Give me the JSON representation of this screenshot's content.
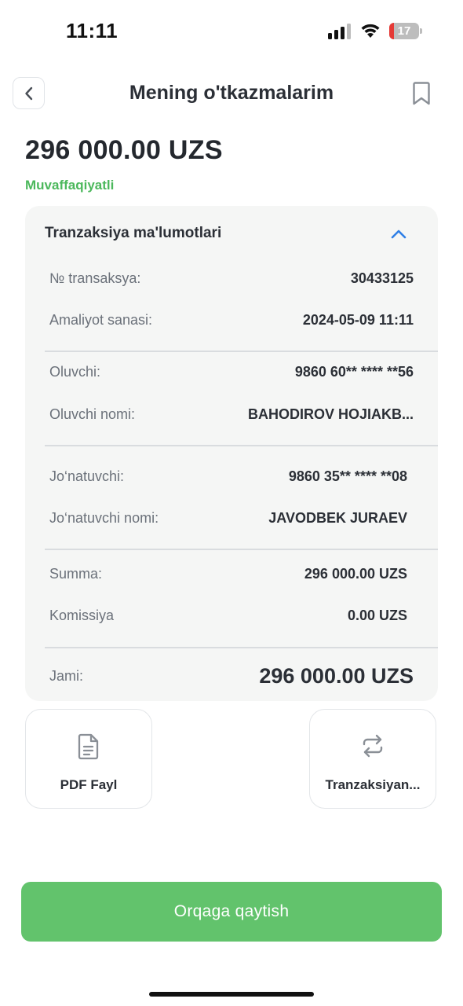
{
  "status_bar": {
    "time": "11:11",
    "battery_level": "17",
    "battery_fraction": 0.17,
    "battery_color": "#e53935",
    "icons": [
      "signal-icon",
      "wifi-icon",
      "battery-icon"
    ]
  },
  "header": {
    "title": "Mening o'tkazmalarim",
    "back_icon": "chevron-left-icon",
    "bookmark_icon": "bookmark-icon"
  },
  "amount": {
    "value": "296 000.00 UZS",
    "status": "Muvaffaqiyatli",
    "status_color": "#4cb85c"
  },
  "details": {
    "title": "Tranzaksiya ma'lumotlari",
    "collapse_icon": "chevron-up-icon",
    "rows": [
      {
        "label": "№ transaksya:",
        "value": "30433125"
      },
      {
        "label": "Amaliyot sanasi:",
        "value": "2024-05-09 11:11"
      },
      {
        "label": "Oluvchi:",
        "value": "9860 60** **** **56"
      },
      {
        "label": "Oluvchi nomi:",
        "value": "BAHODIROV HOJIAKB..."
      },
      {
        "label": "Jo‘natuvchi:",
        "value": "9860 35** **** **08"
      },
      {
        "label": "Jo‘natuvchi nomi:",
        "value": "JAVODBEK JURAEV"
      },
      {
        "label": "Summa:",
        "value": "296 000.00 UZS"
      },
      {
        "label": "Komissiya",
        "value": "0.00 UZS"
      },
      {
        "label": "Jami:",
        "value": "296 000.00 UZS"
      }
    ]
  },
  "actions": [
    {
      "label": "PDF Fayl",
      "icon": "document-icon"
    },
    {
      "label": "Tranzaksiyan...",
      "icon": "repeat-icon"
    }
  ],
  "back_button_label": "Orqaga qaytish",
  "colors": {
    "accent": "#62c36c",
    "card_bg": "#f5f6f5"
  }
}
